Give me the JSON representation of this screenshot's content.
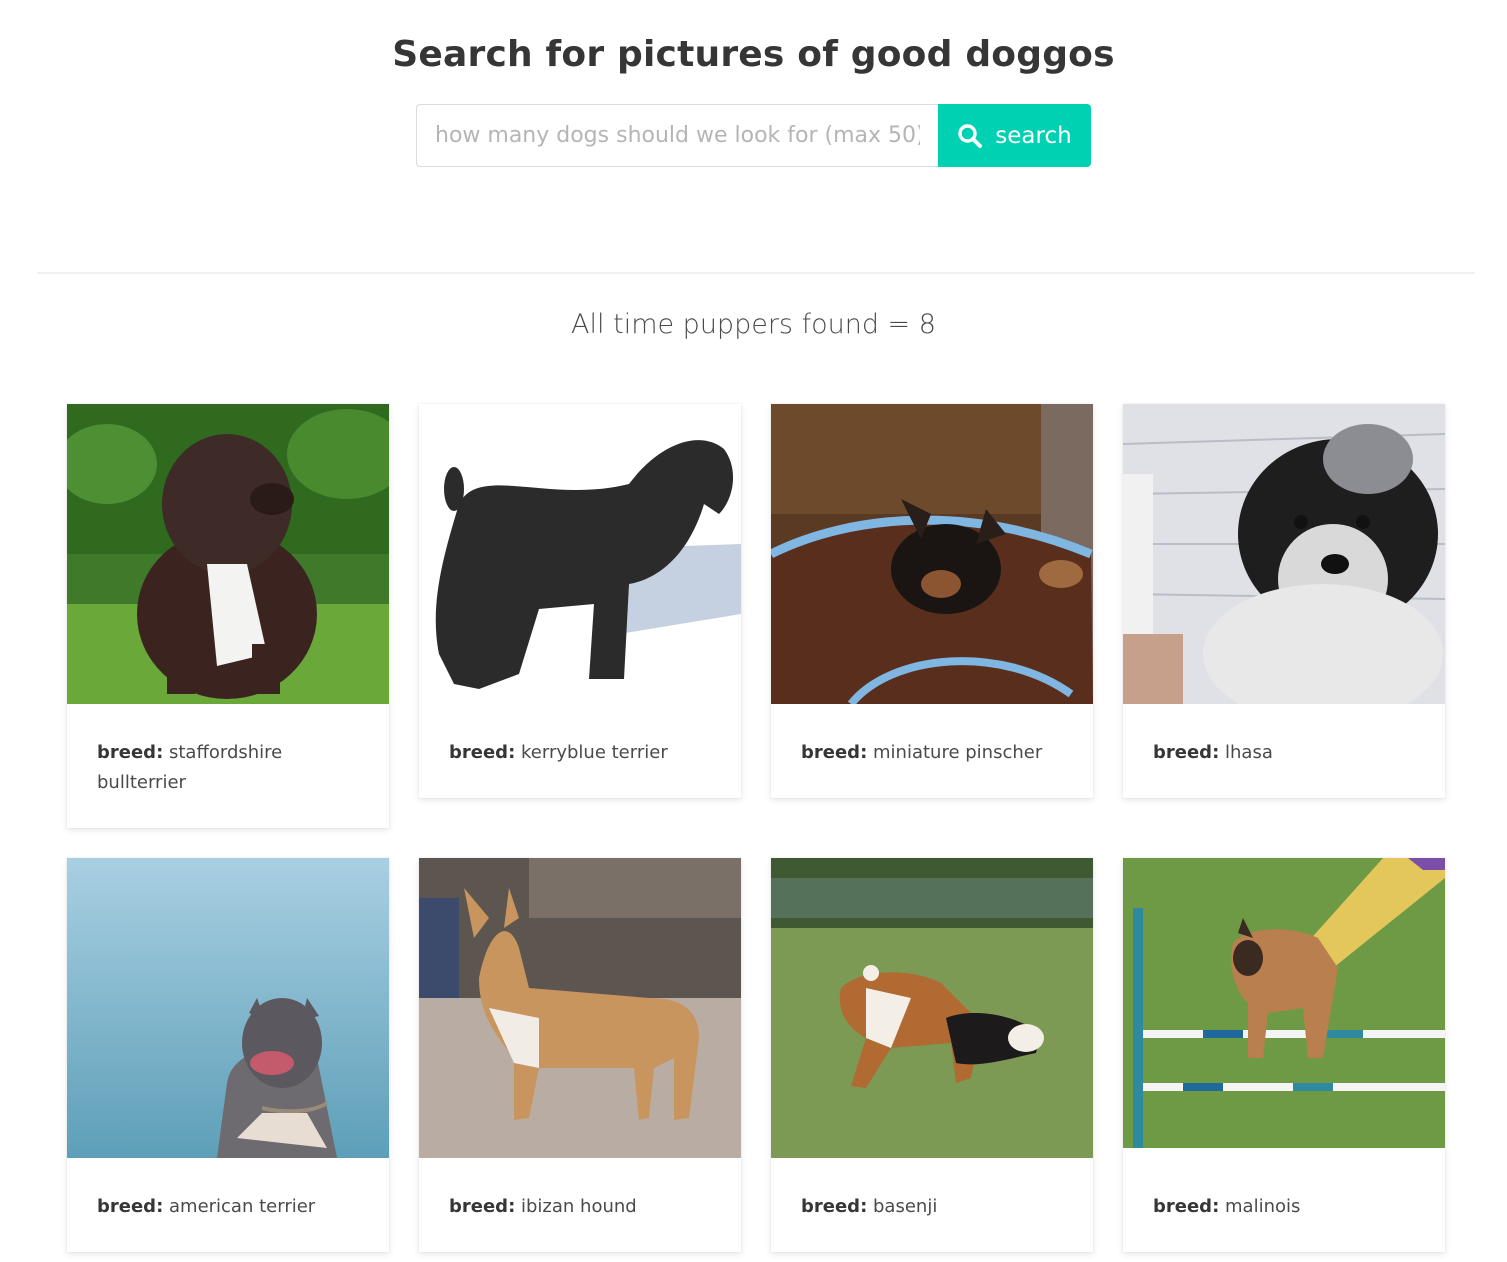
{
  "header": {
    "title": "Search for pictures of good doggos"
  },
  "search": {
    "placeholder": "how many dogs should we look for (max 50)",
    "value": "",
    "button_label": "search",
    "button_color": "#00d1b2"
  },
  "results": {
    "count_text": "All time puppers found = 8"
  },
  "cards": [
    {
      "label": "breed:",
      "breed": "staffordshire bullterrier",
      "image_icon": "dog-photo"
    },
    {
      "label": "breed:",
      "breed": "kerryblue terrier",
      "image_icon": "dog-photo"
    },
    {
      "label": "breed:",
      "breed": "miniature pinscher",
      "image_icon": "dog-photo"
    },
    {
      "label": "breed:",
      "breed": "lhasa",
      "image_icon": "dog-photo"
    },
    {
      "label": "breed:",
      "breed": "american terrier",
      "image_icon": "dog-photo"
    },
    {
      "label": "breed:",
      "breed": "ibizan hound",
      "image_icon": "dog-photo"
    },
    {
      "label": "breed:",
      "breed": "basenji",
      "image_icon": "dog-photo"
    },
    {
      "label": "breed:",
      "breed": "malinois",
      "image_icon": "dog-photo"
    }
  ]
}
